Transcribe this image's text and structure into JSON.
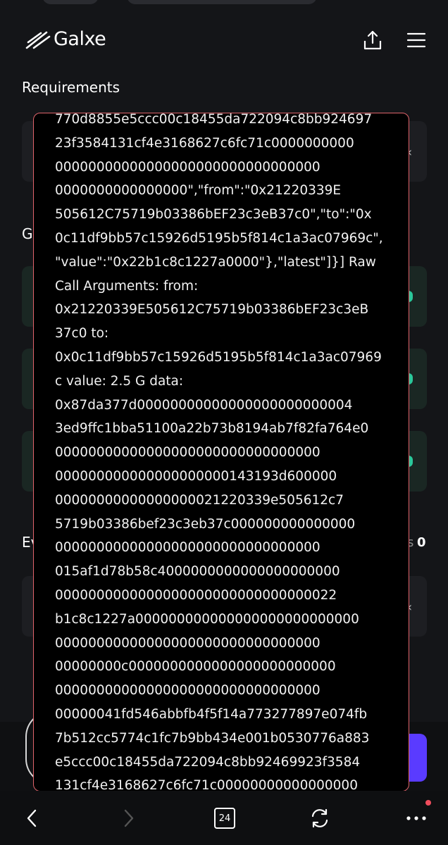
{
  "header": {
    "brand": "Galxe",
    "share_icon": "share-icon",
    "menu_icon": "hamburger-menu-icon"
  },
  "sections": {
    "requirements": "Requirements",
    "g_partial": "G",
    "e_partial": "Ev",
    "count_value": "0",
    "count_partial": "s"
  },
  "error_popup": {
    "lines": [
      "770d8855e5ccc00c18455da722094c8bb924697",
      "23f3584131cf4e3168627c6fc71c0000000000",
      "00000000000000000000000000000000",
      "0000000000000000\",\"from\":\"0x21220339E",
      "505612C75719b03386bEF23c3eB37c0\",\"to\":\"0x",
      "0c11df9bb57c15926d5195b5f814c1a3ac07969c\",",
      "\"value\":\"0x22b1c8c1227a0000\"},\"latest\"]}] Raw",
      "Call Arguments: from:",
      "0x21220339E505612C75719b03386bEF23c3eB",
      "37c0 to:",
      "0x0c11df9bb57c15926d5195b5f814c1a3ac07969",
      "c value: 2.5 G data:",
      "0x87da377d00000000000000000000000004",
      "3ed9ffc1bba51100a22b73b8194ab7f82fa764e0",
      "00000000000000000000000000000000",
      "000000000000000000000143193d600000",
      "00000000000000000021220339e505612c7",
      "5719b03386bef23c3eb37c000000000000000",
      "00000000000000000000000000000000",
      "015af1d78b58c4000000000000000000000",
      "0000000000000000000000000000000022",
      "b1c8c1227a000000000000000000000000000",
      "00000000000000000000000000000000",
      "00000000c0000000000000000000000000",
      "00000000000000000000000000000000",
      "00000041fd546abbfb4f5f14a773277897e074fb",
      "7b512cc5774c1fc7b9bb434e001b0530776a883",
      "e5ccc00c18455da722094c8bb92469923f3584",
      "131cf4e3168627c6fc71c00000000000000000"
    ]
  },
  "navbar": {
    "back_icon": "chevron-left-icon",
    "forward_icon": "chevron-right-icon",
    "tabs_count": "24",
    "refresh_icon": "refresh-icon",
    "more_icon": "more-dots-icon"
  }
}
